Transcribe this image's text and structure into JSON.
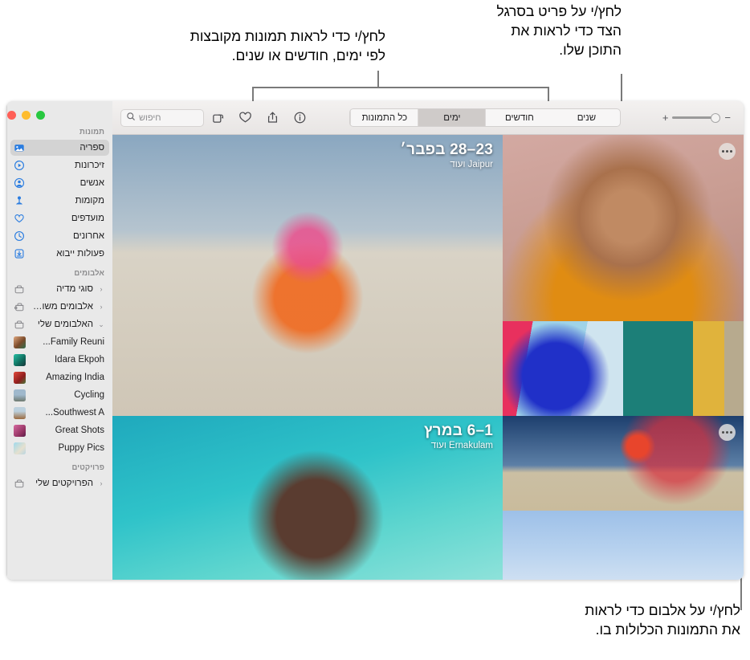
{
  "callouts": {
    "days": "לחץ/י כדי לראות תמונות מקובצות\nלפי ימים, חודשים או שנים.",
    "sidebar": "לחץ/י על פריט בסרגל\nהצד כדי לראות את\nהתוכן שלו.",
    "album": "לחץ/י על אלבום כדי לראות\nאת התמונות הכלולות בו."
  },
  "window": {
    "traffic_lights": [
      {
        "name": "close",
        "color": "#ff5f57"
      },
      {
        "name": "minimize",
        "color": "#febc2e"
      },
      {
        "name": "zoom",
        "color": "#28c840"
      }
    ]
  },
  "toolbar": {
    "search": {
      "placeholder": "חיפוש",
      "icon": "search-icon"
    },
    "buttons": [
      {
        "name": "rotate-icon",
        "label": "סובב"
      },
      {
        "name": "favorite-heart-icon",
        "label": "מועדף"
      },
      {
        "name": "share-icon",
        "label": "שתף"
      },
      {
        "name": "info-icon",
        "label": "מידע"
      }
    ],
    "segmented": {
      "options": [
        "כל התמונות",
        "ימים",
        "חודשים",
        "שנים"
      ],
      "selected": "ימים"
    },
    "zoom_slider": {
      "plus": "+",
      "minus": "−",
      "value": 14
    }
  },
  "sidebar": {
    "sections": [
      {
        "title": "תמונות",
        "items": [
          {
            "label": "ספריה",
            "icon": "library-icon",
            "selected": true
          },
          {
            "label": "זיכרונות",
            "icon": "memories-icon",
            "selected": false
          },
          {
            "label": "אנשים",
            "icon": "people-icon",
            "selected": false
          },
          {
            "label": "מקומות",
            "icon": "places-pin-icon",
            "selected": false
          },
          {
            "label": "מועדפים",
            "icon": "heart-icon",
            "selected": false
          },
          {
            "label": "אחרונים",
            "icon": "clock-icon",
            "selected": false
          },
          {
            "label": "פעולות ייבוא",
            "icon": "import-icon",
            "selected": false
          }
        ]
      },
      {
        "title": "אלבומים",
        "items": [
          {
            "label": "סוגי מדיה",
            "icon": "folder-icon",
            "chevron": "‹"
          },
          {
            "label": "אלבומים משותפים",
            "icon": "shared-folder-icon",
            "chevron": "‹"
          },
          {
            "label": "האלבומים שלי",
            "icon": "folder-icon",
            "chevron": "⌄"
          },
          {
            "label": "Family Reuni...",
            "icon": "album-thumb",
            "thumb": "#c8764f"
          },
          {
            "label": "Idara Ekpoh",
            "icon": "album-thumb",
            "thumb": "#1faa8f"
          },
          {
            "label": "Amazing India",
            "icon": "album-thumb",
            "thumb": "#c02d2d"
          },
          {
            "label": "Cycling",
            "icon": "album-thumb",
            "thumb": "#7d93a8"
          },
          {
            "label": "Southwest A...",
            "icon": "album-thumb",
            "thumb": "#9c6b3f"
          },
          {
            "label": "Great Shots",
            "icon": "album-thumb",
            "thumb": "#b8487f"
          },
          {
            "label": "Puppy Pics",
            "icon": "album-thumb",
            "thumb": "#7fc6e0"
          }
        ]
      },
      {
        "title": "פרויקטים",
        "items": [
          {
            "label": "הפרויקטים שלי",
            "icon": "folder-icon",
            "chevron": "‹"
          }
        ]
      }
    ]
  },
  "grid": {
    "groups": [
      {
        "date": "23–28 בפבר׳",
        "place": "Jaipur ועוד"
      },
      {
        "date": "1–6 במרץ",
        "place": "Ernakulam ועוד"
      }
    ]
  }
}
